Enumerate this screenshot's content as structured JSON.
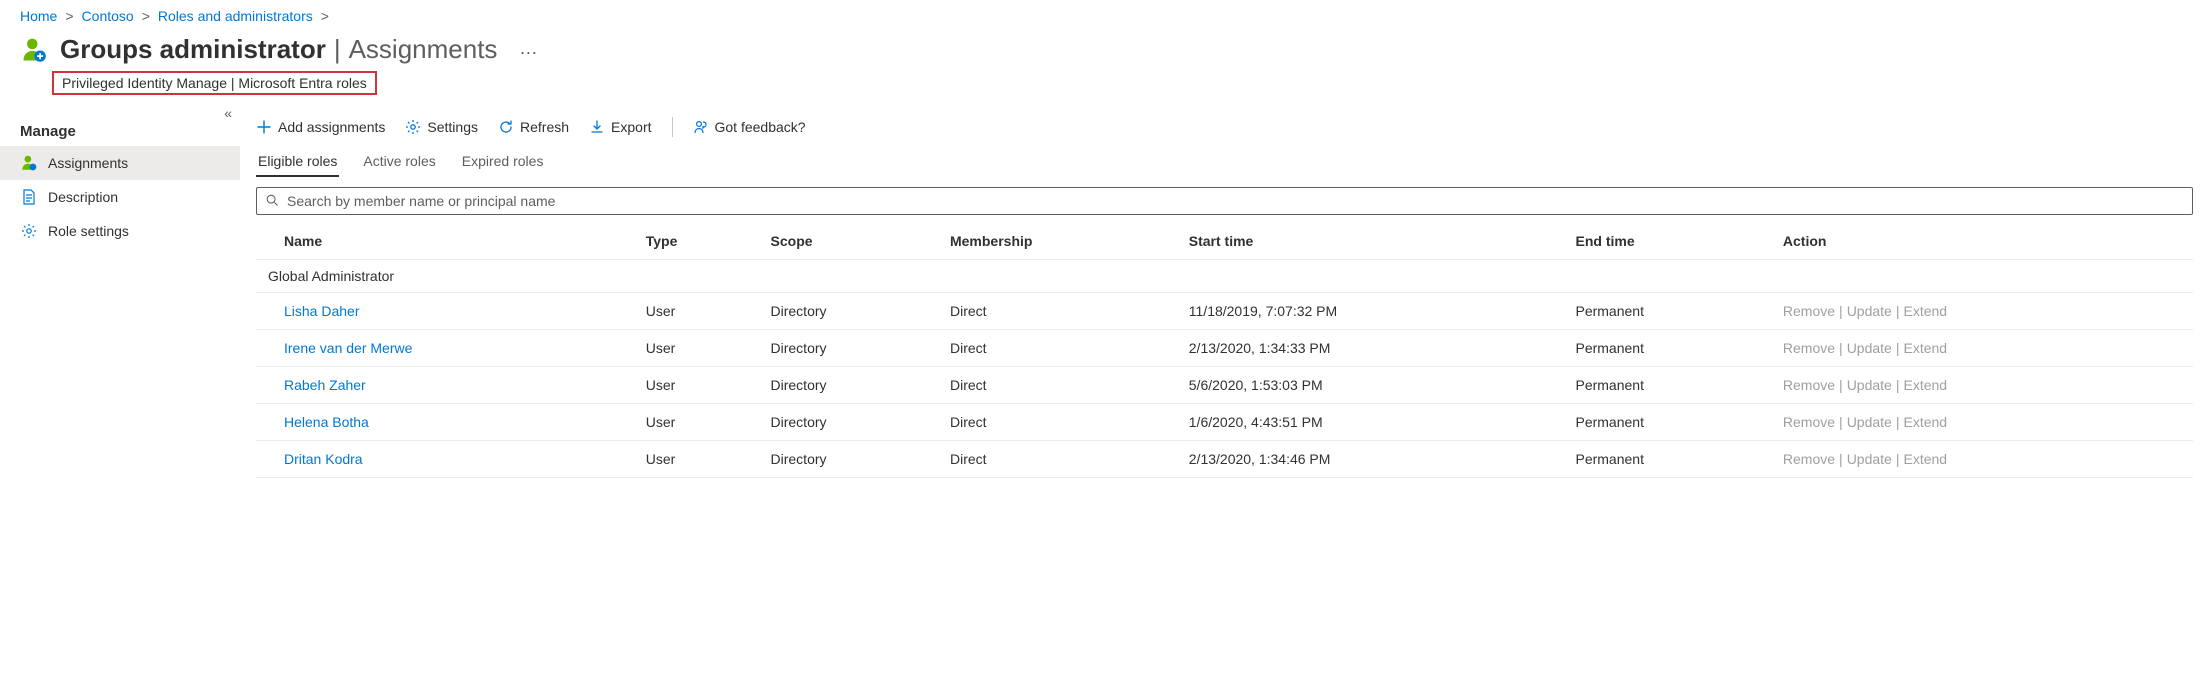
{
  "breadcrumb": [
    {
      "label": "Home"
    },
    {
      "label": "Contoso"
    },
    {
      "label": "Roles and administrators"
    }
  ],
  "header": {
    "title": "Groups administrator",
    "separator": "|",
    "section": "Assignments",
    "more": "···",
    "subtitle": "Privileged Identity Manage | Microsoft Entra roles"
  },
  "sidebar": {
    "collapse_glyph": "«",
    "heading": "Manage",
    "items": [
      {
        "label": "Assignments",
        "active": true
      },
      {
        "label": "Description",
        "active": false
      },
      {
        "label": "Role settings",
        "active": false
      }
    ]
  },
  "toolbar": {
    "add": "Add assignments",
    "settings": "Settings",
    "refresh": "Refresh",
    "export": "Export",
    "feedback": "Got feedback?"
  },
  "tabs": [
    {
      "label": "Eligible roles",
      "active": true
    },
    {
      "label": "Active roles",
      "active": false
    },
    {
      "label": "Expired roles",
      "active": false
    }
  ],
  "search": {
    "placeholder": "Search by member name or principal name"
  },
  "columns": {
    "name": "Name",
    "type": "Type",
    "scope": "Scope",
    "membership": "Membership",
    "start": "Start time",
    "end": "End time",
    "action": "Action"
  },
  "group_label": "Global Administrator",
  "action_labels": {
    "remove": "Remove",
    "update": "Update",
    "extend": "Extend"
  },
  "rows": [
    {
      "name": "Lisha Daher",
      "type": "User",
      "scope": "Directory",
      "membership": "Direct",
      "start": "11/18/2019, 7:07:32 PM",
      "end": "Permanent"
    },
    {
      "name": "Irene van der Merwe",
      "type": "User",
      "scope": "Directory",
      "membership": "Direct",
      "start": "2/13/2020, 1:34:33 PM",
      "end": "Permanent"
    },
    {
      "name": "Rabeh Zaher",
      "type": "User",
      "scope": "Directory",
      "membership": "Direct",
      "start": "5/6/2020, 1:53:03 PM",
      "end": "Permanent"
    },
    {
      "name": "Helena Botha",
      "type": "User",
      "scope": "Directory",
      "membership": "Direct",
      "start": "1/6/2020, 4:43:51 PM",
      "end": "Permanent"
    },
    {
      "name": "Dritan Kodra",
      "type": "User",
      "scope": "Directory",
      "membership": "Direct",
      "start": "2/13/2020, 1:34:46 PM",
      "end": "Permanent"
    }
  ]
}
